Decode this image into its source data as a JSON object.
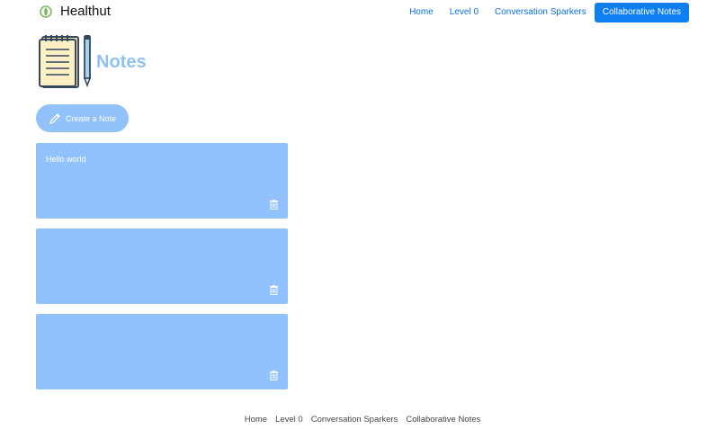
{
  "brand": {
    "name": "Healthut",
    "logo_icon": "leaf-logo-icon"
  },
  "nav": {
    "items": [
      {
        "label": "Home"
      },
      {
        "label": "Level 0"
      },
      {
        "label": "Conversation Sparkers"
      },
      {
        "label": "Collaborative Notes",
        "active": true
      }
    ]
  },
  "page": {
    "title": "Notes",
    "header_icon": "notepad-icon"
  },
  "create_button": {
    "label": "Create a Note",
    "icon": "pencil-icon"
  },
  "notes": [
    {
      "text": "Hello world"
    },
    {
      "text": ""
    },
    {
      "text": ""
    }
  ],
  "footer": {
    "links": [
      {
        "label": "Home"
      },
      {
        "label": "Level 0"
      },
      {
        "label": "Conversation Sparkers"
      },
      {
        "label": "Collaborative Notes"
      }
    ]
  },
  "colors": {
    "accent": "#0d7ff2",
    "note_bg": "#92c2fd",
    "title": "#8fc1f5"
  }
}
